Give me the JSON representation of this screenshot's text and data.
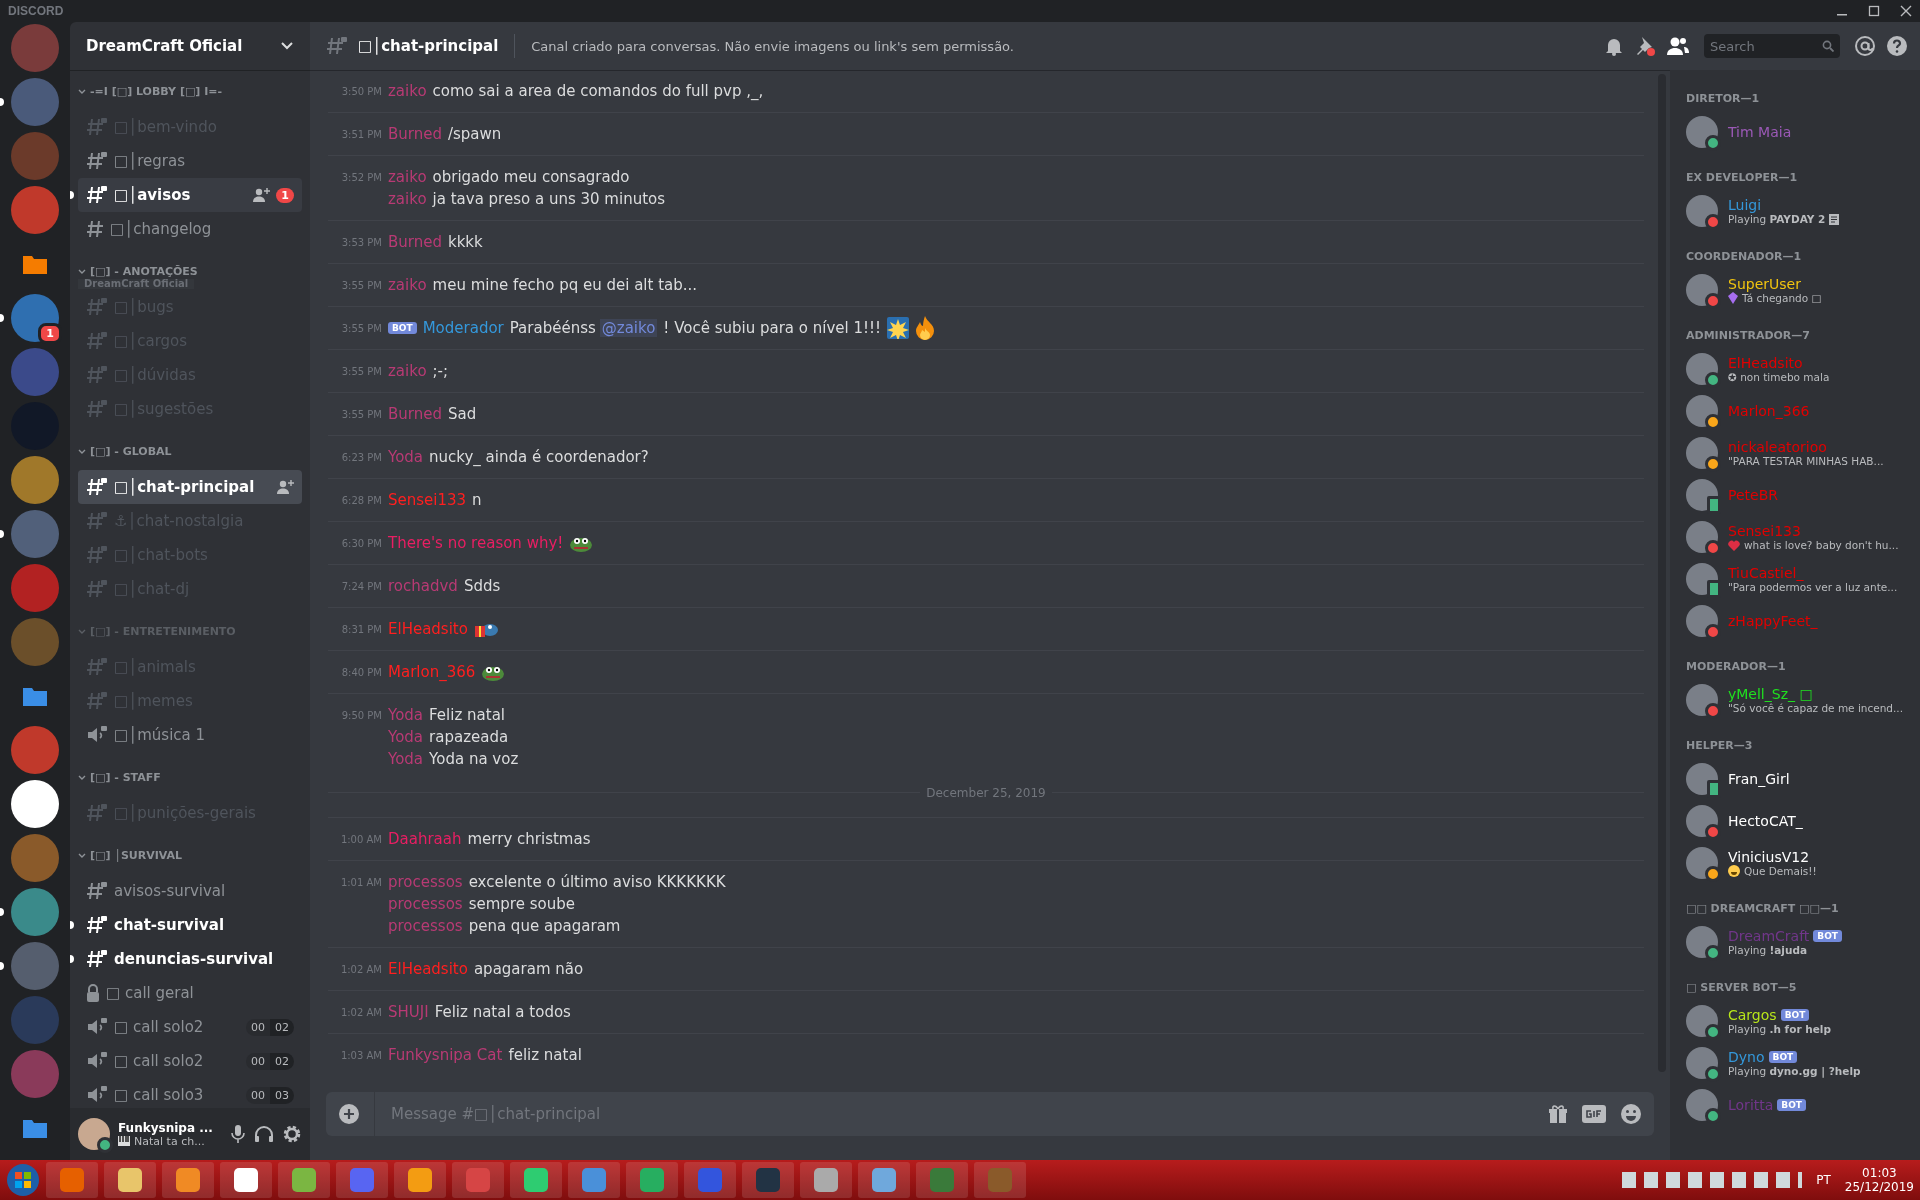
{
  "app_title": "DISCORD",
  "servers": [
    {
      "kind": "avatar",
      "unread": false
    },
    {
      "kind": "avatar",
      "unread": true
    },
    {
      "kind": "avatar",
      "unread": false
    },
    {
      "kind": "avatar",
      "unread": false
    },
    {
      "kind": "folder",
      "unread": false
    },
    {
      "kind": "avatar",
      "unread": true,
      "badge": "1"
    },
    {
      "kind": "avatar",
      "unread": false
    },
    {
      "kind": "avatar",
      "unread": false
    },
    {
      "kind": "avatar",
      "unread": false
    },
    {
      "kind": "avatar",
      "unread": true
    },
    {
      "kind": "avatar",
      "unread": false
    },
    {
      "kind": "avatar",
      "unread": false
    },
    {
      "kind": "folder",
      "unread": false
    },
    {
      "kind": "avatar",
      "unread": false
    },
    {
      "kind": "avatar",
      "unread": false
    },
    {
      "kind": "avatar",
      "unread": false
    },
    {
      "kind": "avatar",
      "unread": true
    },
    {
      "kind": "avatar",
      "unread": true
    },
    {
      "kind": "avatar",
      "unread": false
    },
    {
      "kind": "avatar",
      "unread": false
    },
    {
      "kind": "folder",
      "unread": false
    }
  ],
  "sidebar": {
    "server_name": "DreamCraft Oficial",
    "drag_label": "DreamCraft Oficial",
    "categories": [
      {
        "name": "-=I [□] LOBBY [□] I=-",
        "muted": false,
        "channels": [
          {
            "kind": "private",
            "name": "□│bem-vindo",
            "muted": true,
            "unread": false,
            "selected": false
          },
          {
            "kind": "private",
            "name": "□│regras",
            "muted": false,
            "unread": false,
            "selected": false
          },
          {
            "kind": "private",
            "name": "□│avisos",
            "muted": false,
            "unread": true,
            "selected": false,
            "hovered": true,
            "invite": true,
            "badge": "1"
          },
          {
            "kind": "text",
            "name": "□│changelog",
            "muted": false,
            "unread": false,
            "selected": false
          }
        ]
      },
      {
        "name": "[□] - ANOTAÇÕES",
        "muted": false,
        "channels": [
          {
            "kind": "private",
            "name": "□│bugs",
            "muted": true,
            "unread": false,
            "selected": false
          },
          {
            "kind": "private",
            "name": "□│cargos",
            "muted": true,
            "unread": false,
            "selected": false
          },
          {
            "kind": "private",
            "name": "□│dúvidas",
            "muted": true,
            "unread": false,
            "selected": false
          },
          {
            "kind": "private",
            "name": "□│sugestões",
            "muted": true,
            "unread": false,
            "selected": false
          }
        ]
      },
      {
        "name": "[□] - GLOBAL",
        "muted": false,
        "channels": [
          {
            "kind": "private",
            "name": "□│chat-principal",
            "muted": false,
            "unread": false,
            "selected": true,
            "invite": true
          },
          {
            "kind": "private",
            "name": "⚓│chat-nostalgia",
            "muted": true,
            "unread": false,
            "selected": false
          },
          {
            "kind": "private",
            "name": "□│chat-bots",
            "muted": true,
            "unread": false,
            "selected": false
          },
          {
            "kind": "private",
            "name": "□│chat-dj",
            "muted": true,
            "unread": false,
            "selected": false
          }
        ]
      },
      {
        "name": "[□] - ENTRETENIMENTO",
        "muted": true,
        "channels": [
          {
            "kind": "private",
            "name": "□│animals",
            "muted": true,
            "unread": false,
            "selected": false
          },
          {
            "kind": "private",
            "name": "□│memes",
            "muted": true,
            "unread": false,
            "selected": false
          },
          {
            "kind": "voice",
            "name": "□│música 1",
            "muted": false,
            "unread": false,
            "selected": false
          }
        ]
      },
      {
        "name": "[□] - STAFF",
        "muted": false,
        "channels": [
          {
            "kind": "private",
            "name": "□│punições-gerais",
            "muted": true,
            "unread": false,
            "selected": false
          }
        ]
      },
      {
        "name": "[□] │SURVIVAL",
        "muted": false,
        "channels": [
          {
            "kind": "private",
            "name": "avisos-survival",
            "muted": false,
            "unread": false,
            "selected": false
          },
          {
            "kind": "private",
            "name": "chat-survival",
            "muted": false,
            "unread": true,
            "selected": false
          },
          {
            "kind": "private",
            "name": "denuncias-survival",
            "muted": false,
            "unread": true,
            "selected": false
          },
          {
            "kind": "locked",
            "name": "□ call geral",
            "muted": false,
            "unread": false,
            "selected": false
          },
          {
            "kind": "voice",
            "name": "□ call solo2",
            "muted": false,
            "unread": false,
            "selected": false,
            "limit": [
              "00",
              "02"
            ]
          },
          {
            "kind": "voice",
            "name": "□ call solo2",
            "muted": false,
            "unread": false,
            "selected": false,
            "limit": [
              "00",
              "02"
            ]
          },
          {
            "kind": "voice",
            "name": "□ call solo3",
            "muted": false,
            "unread": false,
            "selected": false,
            "limit": [
              "00",
              "03"
            ]
          }
        ]
      }
    ]
  },
  "user_panel": {
    "name": "Funkysnipa ...",
    "kind": "online",
    "activity": "Natal ta ch..."
  },
  "header": {
    "channel": "□│chat-principal",
    "topic": "Canal criado para conversas. Não envie imagens ou link's sem permissão.",
    "search_placeholder": "Search"
  },
  "messages": [
    {
      "kind": "group",
      "time": "3:50 PM",
      "lines": [
        {
          "author": "zaiko",
          "color": "#b83a74",
          "parts": [
            {
              "kind": "text",
              "text": "como sai a area de comandos do full pvp ,_,"
            }
          ]
        }
      ]
    },
    {
      "kind": "group",
      "time": "3:51 PM",
      "lines": [
        {
          "author": "Burned",
          "color": "#b83a74",
          "parts": [
            {
              "kind": "text",
              "text": "/spawn"
            }
          ]
        }
      ]
    },
    {
      "kind": "group",
      "time": "3:52 PM",
      "lines": [
        {
          "author": "zaiko",
          "color": "#b83a74",
          "parts": [
            {
              "kind": "text",
              "text": "obrigado meu consagrado"
            }
          ]
        },
        {
          "author": "zaiko",
          "color": "#b83a74",
          "parts": [
            {
              "kind": "text",
              "text": "ja tava preso a uns 30 minutos"
            }
          ]
        }
      ]
    },
    {
      "kind": "group",
      "time": "3:53 PM",
      "lines": [
        {
          "author": "Burned",
          "color": "#b83a74",
          "parts": [
            {
              "kind": "text",
              "text": "kkkk"
            }
          ]
        }
      ]
    },
    {
      "kind": "group",
      "time": "3:55 PM",
      "lines": [
        {
          "author": "zaiko",
          "color": "#b83a74",
          "parts": [
            {
              "kind": "text",
              "text": "meu mine fecho pq eu dei alt tab..."
            }
          ]
        }
      ]
    },
    {
      "kind": "group",
      "time": "3:55 PM",
      "lines": [
        {
          "author": "Moderador",
          "color": "#3498db",
          "badge": "BOT",
          "parts": [
            {
              "kind": "text",
              "text": "Parabéénss"
            },
            {
              "kind": "mention",
              "text": "@zaiko"
            },
            {
              "kind": "text",
              "text": "! Você subiu para o nível 1!!!"
            },
            {
              "kind": "burst"
            },
            {
              "kind": "fire"
            }
          ]
        }
      ]
    },
    {
      "kind": "group",
      "time": "3:55 PM",
      "lines": [
        {
          "author": "zaiko",
          "color": "#b83a74",
          "parts": [
            {
              "kind": "text",
              "text": ";-;"
            }
          ]
        }
      ]
    },
    {
      "kind": "group",
      "time": "3:55 PM",
      "lines": [
        {
          "author": "Burned",
          "color": "#b83a74",
          "parts": [
            {
              "kind": "text",
              "text": "Sad"
            }
          ]
        }
      ]
    },
    {
      "kind": "group",
      "time": "6:23 PM",
      "lines": [
        {
          "author": "Yoda",
          "color": "#b83a74",
          "parts": [
            {
              "kind": "text",
              "text": "nucky_ ainda é coordenador?"
            }
          ]
        }
      ]
    },
    {
      "kind": "group",
      "time": "6:28 PM",
      "lines": [
        {
          "author": "Sensei133",
          "color": "#ff1f1f",
          "parts": [
            {
              "kind": "text",
              "text": "n"
            }
          ]
        }
      ]
    },
    {
      "kind": "group",
      "time": "6:30 PM",
      "lines": [
        {
          "author": "There's no reason why!",
          "color": "#e91e63",
          "parts": [
            {
              "kind": "frog"
            }
          ]
        }
      ]
    },
    {
      "kind": "group",
      "time": "7:24 PM",
      "lines": [
        {
          "author": "rochadvd",
          "color": "#b83a74",
          "parts": [
            {
              "kind": "text",
              "text": "Sdds"
            }
          ]
        }
      ]
    },
    {
      "kind": "group",
      "time": "8:31 PM",
      "lines": [
        {
          "author": "ElHeadsito",
          "color": "#ff1f1f",
          "parts": [
            {
              "kind": "gift"
            }
          ]
        }
      ]
    },
    {
      "kind": "group",
      "time": "8:40 PM",
      "lines": [
        {
          "author": "Marlon_366",
          "color": "#ff1f1f",
          "parts": [
            {
              "kind": "frog"
            }
          ]
        }
      ]
    },
    {
      "kind": "group",
      "time": "9:50 PM",
      "lines": [
        {
          "author": "Yoda",
          "color": "#b83a74",
          "parts": [
            {
              "kind": "text",
              "text": "Feliz natal"
            }
          ]
        },
        {
          "author": "Yoda",
          "color": "#b83a74",
          "parts": [
            {
              "kind": "text",
              "text": "rapazeada"
            }
          ]
        },
        {
          "author": "Yoda",
          "color": "#b83a74",
          "parts": [
            {
              "kind": "text",
              "text": "Yoda na voz"
            }
          ]
        }
      ]
    },
    {
      "kind": "divider",
      "text": "December 25, 2019"
    },
    {
      "kind": "group",
      "time": "1:00 AM",
      "lines": [
        {
          "author": "Daahraah",
          "color": "#e91e63",
          "parts": [
            {
              "kind": "text",
              "text": "merry christmas"
            }
          ]
        }
      ]
    },
    {
      "kind": "group",
      "time": "1:01 AM",
      "lines": [
        {
          "author": "processos",
          "color": "#b83a74",
          "parts": [
            {
              "kind": "text",
              "text": "excelente o último aviso KKKKKKK"
            }
          ]
        },
        {
          "author": "processos",
          "color": "#b83a74",
          "parts": [
            {
              "kind": "text",
              "text": "sempre soube"
            }
          ]
        },
        {
          "author": "processos",
          "color": "#b83a74",
          "parts": [
            {
              "kind": "text",
              "text": "pena que apagaram"
            }
          ]
        }
      ]
    },
    {
      "kind": "group",
      "time": "1:02 AM",
      "lines": [
        {
          "author": "ElHeadsito",
          "color": "#ff1f1f",
          "parts": [
            {
              "kind": "text",
              "text": "apagaram não"
            }
          ]
        }
      ]
    },
    {
      "kind": "group",
      "time": "1:02 AM",
      "lines": [
        {
          "author": "SHUJI",
          "color": "#b83a74",
          "parts": [
            {
              "kind": "text",
              "text": "Feliz natal a todos"
            }
          ]
        }
      ]
    },
    {
      "kind": "group",
      "time": "1:03 AM",
      "lines": [
        {
          "author": "Funkysnipa Cat",
          "color": "#b83a74",
          "parts": [
            {
              "kind": "text",
              "text": "feliz natal"
            }
          ]
        }
      ]
    }
  ],
  "composer": {
    "placeholder": "Message #□│chat-principal"
  },
  "members": [
    {
      "title": "DIRETOR—1",
      "members": [
        {
          "name": "Tim Maia",
          "color": "#9b59b6",
          "kind": "online"
        }
      ]
    },
    {
      "title": "EX DEVELOPER—1",
      "members": [
        {
          "name": "Luigi",
          "color": "#3498db",
          "kind": "dnd",
          "activity": "Playing **PAYDAY 2**",
          "activity_emoji": {
            "kind": "document"
          }
        }
      ]
    },
    {
      "title": "COORDENADOR—1",
      "members": [
        {
          "name": "SuperUser",
          "color": "#f1c40f",
          "kind": "dnd",
          "activity": "Tá chegando □",
          "activity_emoji": {
            "kind": "gem"
          }
        }
      ]
    },
    {
      "title": "ADMINISTRADOR—7",
      "members": [
        {
          "name": "ElHeadsito",
          "color": "#e00000",
          "kind": "online",
          "activity": "✪ non timebo mala"
        },
        {
          "name": "Marlon_366",
          "color": "#e00000",
          "kind": "idle"
        },
        {
          "name": "nickaleatorioo",
          "color": "#e00000",
          "kind": "idle",
          "activity": "\"PARA TESTAR MINHAS HAB..."
        },
        {
          "name": "PeteBR",
          "color": "#e00000",
          "kind": "mobile"
        },
        {
          "name": "Sensei133",
          "color": "#e00000",
          "kind": "dnd",
          "activity": "what is love? baby don't hu...",
          "activity_emoji": {
            "kind": "heart"
          }
        },
        {
          "name": "TiuCastiel_",
          "color": "#e00000",
          "kind": "mobile",
          "activity": "\"Para podermos ver a luz ante..."
        },
        {
          "name": "zHappyFeet_",
          "color": "#e00000",
          "kind": "dnd"
        }
      ]
    },
    {
      "title": "MODERADOR—1",
      "members": [
        {
          "name": "yMell_Sz_ □",
          "color": "#1fe01f",
          "kind": "dnd",
          "activity": "\"Só você é capaz de me incend..."
        }
      ]
    },
    {
      "title": "HELPER—3",
      "members": [
        {
          "name": "Fran_Girl",
          "color": "#ffffff",
          "kind": "mobile"
        },
        {
          "name": "HectoCAT_",
          "color": "#ffffff",
          "kind": "dnd"
        },
        {
          "name": "ViniciusV12",
          "color": "#ffffff",
          "kind": "idle",
          "activity": "Que Demais!!",
          "activity_emoji": {
            "kind": "smile"
          }
        }
      ]
    },
    {
      "title": "□□ DREAMCRAFT □□—1",
      "members": [
        {
          "name": "DreamCraft",
          "color": "#71368a",
          "kind": "online",
          "badge": "BOT",
          "activity": "Playing **!ajuda**"
        }
      ]
    },
    {
      "title": "□ SERVER BOT—5",
      "members": [
        {
          "name": "Cargos",
          "color": "#b8e61a",
          "kind": "online",
          "badge": "BOT",
          "activity": "Playing **.h for help**"
        },
        {
          "name": "Dyno",
          "color": "#3498db",
          "kind": "online",
          "badge": "BOT",
          "activity": "Playing **dyno.gg | ?help**"
        },
        {
          "name": "Loritta",
          "color": "#71368a",
          "kind": "online",
          "badge": "BOT"
        }
      ]
    }
  ],
  "taskbar": {
    "language": "PT",
    "time": "01:03",
    "date": "25/12/2019"
  }
}
